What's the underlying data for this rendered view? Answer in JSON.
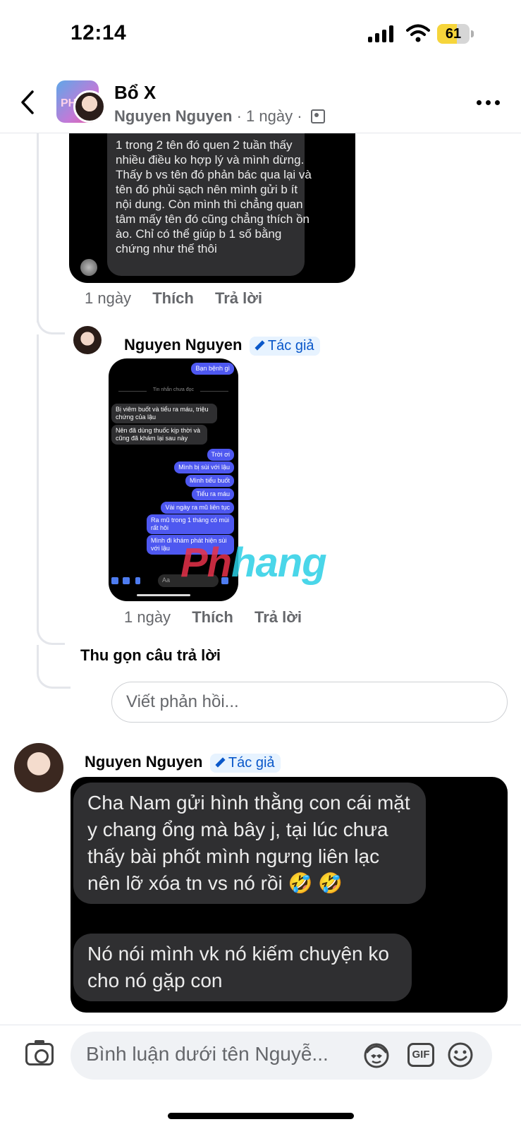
{
  "status_bar": {
    "time": "12:14",
    "battery": "61",
    "battery_level": 0.61
  },
  "header": {
    "title": "Bổ X",
    "author": "Nguyen Nguyen",
    "sep1": "·",
    "time": "1 ngày",
    "sep2": "·",
    "group_avatar_text": "PH"
  },
  "comment1": {
    "image_text": "1 trong 2 tên đó quen 2 tuần thấy nhiều điều ko hợp lý và mình dừng. Thấy b vs tên đó phản bác qua lại và tên đó phủi sạch nên mình gửi b ít nội dung. Còn mình thì chẳng quan tâm mấy tên đó cũng chẳng thích ồn ào. Chỉ có thể giúp b 1 số bằng chứng như thế thôi",
    "time": "1 ngày",
    "like": "Thích",
    "reply": "Trả lời"
  },
  "reply1": {
    "name": "Nguyen Nguyen",
    "badge": "Tác giả",
    "time": "1 ngày",
    "like": "Thích",
    "reply": "Trả lời",
    "screenshot": {
      "top_bubble": "Bạn bệnh gì",
      "unread": "Tin nhắn chưa đọc",
      "in1": "Bị viêm buốt và tiểu ra máu, triệu chứng của lậu",
      "in2": "Nên đã dùng thuốc kịp thời và cũng đã khám lại sau này",
      "out1": "Trời ơi",
      "out2": "Mình bị sùi với lậu",
      "out3": "Mình tiểu buốt",
      "out4": "Tiểu ra máu",
      "out5": "Vài ngày ra mũ liên tục",
      "out6": "Ra mũ trong 1 tháng có mùi rất hôi",
      "out7": "Mình đi khám phát hiện sùi với lậu",
      "input": "Aa"
    }
  },
  "watermark": {
    "part1": "Ph",
    "part2": "hang"
  },
  "collapse_label": "Thu gọn câu trả lời",
  "reply_input_placeholder": "Viết phản hồi...",
  "comment2": {
    "name": "Nguyen Nguyen",
    "badge": "Tác giả",
    "bubble1": "Cha Nam gửi hình thằng con cái mặt y chang ổng mà bây j, tại lúc chưa thấy bài phốt mình ngưng liên lạc nên lỡ xóa tn vs nó rồi 🤣 🤣",
    "bubble2": "Nó nói mình vk nó kiếm chuyện ko cho nó gặp con"
  },
  "bottom_bar": {
    "placeholder": "Bình luận dưới tên Nguyễ...",
    "gif": "GIF"
  },
  "colors": {
    "accent_blue": "#0a58ca",
    "badge_bg": "#e7f3ff",
    "outgoing_bubble": "#4e58f0",
    "dark_bubble": "#2f2f31"
  }
}
